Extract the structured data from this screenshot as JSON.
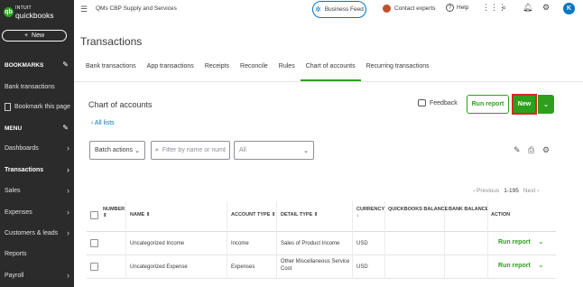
{
  "sidebar": {
    "logo_brand": "INTUIT",
    "logo_product": "quickbooks",
    "new_label": "New",
    "bookmarks_heading": "BOOKMARKS",
    "menu_heading": "MENU",
    "items": [
      {
        "label": "Bank transactions"
      },
      {
        "label": "Bookmark this page"
      },
      {
        "label": "Dashboards"
      },
      {
        "label": "Transactions"
      },
      {
        "label": "Sales"
      },
      {
        "label": "Expenses"
      },
      {
        "label": "Customers & leads"
      },
      {
        "label": "Reports"
      },
      {
        "label": "Payroll"
      }
    ]
  },
  "topbar": {
    "company": "QMs CBP Supply and Services",
    "business_feed": "Business Feed",
    "contact_experts": "Contact experts",
    "help": "Help",
    "avatar_letter": "K"
  },
  "page": {
    "title": "Transactions",
    "tabs": [
      {
        "label": "Bank transactions"
      },
      {
        "label": "App transactions"
      },
      {
        "label": "Receipts"
      },
      {
        "label": "Reconcile"
      },
      {
        "label": "Rules"
      },
      {
        "label": "Chart of accounts"
      },
      {
        "label": "Recurring transactions"
      }
    ],
    "active_tab": "Chart of accounts"
  },
  "coa": {
    "title": "Chart of accounts",
    "all_lists": "All lists",
    "feedback": "Feedback",
    "run_report": "Run report",
    "new": "New",
    "batch_actions": "Batch actions",
    "search_placeholder": "Filter by name or number",
    "filter_value": "All",
    "pagination": {
      "prev": "Previous",
      "range": "1-195",
      "next": "Next"
    }
  },
  "table": {
    "headers": {
      "number": "NUMBER",
      "name": "NAME",
      "account_type": "ACCOUNT TYPE",
      "detail_type": "DETAIL TYPE",
      "currency": "CURRENCY",
      "qb_balance": "QUICKBOOKS BALANCE",
      "bank_balance": "BANK BALANCE",
      "action": "ACTION"
    },
    "rows": [
      {
        "number": "",
        "name": "Uncategorized Income",
        "account_type": "Income",
        "detail_type": "Sales of Product Income",
        "currency": "USD",
        "qb_balance": "",
        "bank_balance": "",
        "action": "Run report"
      },
      {
        "number": "",
        "name": "Uncategorized Expense",
        "account_type": "Expenses",
        "detail_type": "Other Miscellaneous Service Cost",
        "currency": "USD",
        "qb_balance": "",
        "bank_balance": "",
        "action": "Run report"
      }
    ]
  },
  "colors": {
    "brand_green": "#2ca01c",
    "link_blue": "#0077c5",
    "highlight_red": "#d52b1e",
    "sidebar_bg": "#2b2b2b"
  }
}
